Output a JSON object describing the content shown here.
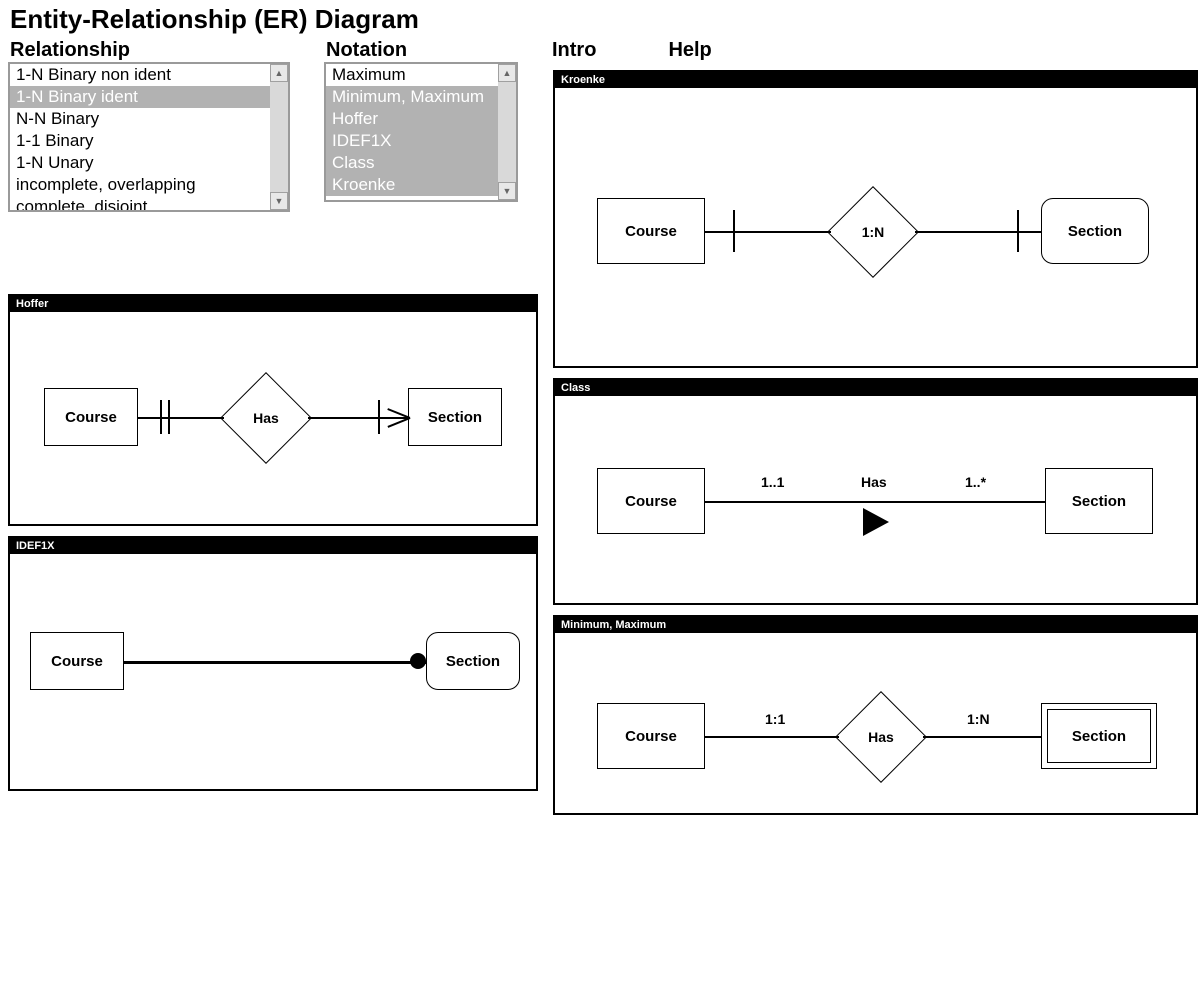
{
  "title": "Entity-Relationship (ER) Diagram",
  "relationship": {
    "label": "Relationship",
    "items": [
      "1-N Binary non ident",
      "1-N Binary ident",
      "N-N Binary",
      "1-1 Binary",
      "1-N Unary",
      "incomplete, overlapping",
      "complete, disjoint"
    ],
    "selected": "1-N Binary ident"
  },
  "notation": {
    "label": "Notation",
    "items": [
      "Maximum",
      "Minimum, Maximum",
      "Hoffer",
      "IDEF1X",
      "Class",
      "Kroenke"
    ],
    "selected": [
      "Minimum, Maximum",
      "Hoffer",
      "IDEF1X",
      "Class",
      "Kroenke"
    ]
  },
  "nav": {
    "intro": "Intro",
    "help": "Help"
  },
  "panels": {
    "kroenke": {
      "title": "Kroenke",
      "left_entity": "Course",
      "right_entity": "Section",
      "relation": "1:N"
    },
    "hoffer": {
      "title": "Hoffer",
      "left_entity": "Course",
      "right_entity": "Section",
      "relation": "Has"
    },
    "idef1x": {
      "title": "IDEF1X",
      "left_entity": "Course",
      "right_entity": "Section"
    },
    "class": {
      "title": "Class",
      "left_entity": "Course",
      "right_entity": "Section",
      "relation": "Has",
      "left_card": "1..1",
      "right_card": "1..*"
    },
    "minmax": {
      "title": "Minimum, Maximum",
      "left_entity": "Course",
      "right_entity": "Section",
      "relation": "Has",
      "left_card": "1:1",
      "right_card": "1:N"
    }
  }
}
